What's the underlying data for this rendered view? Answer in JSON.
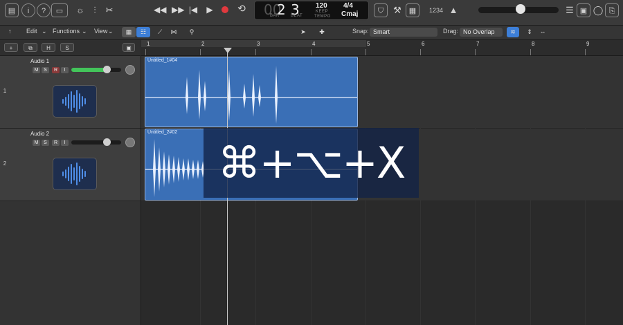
{
  "control_bar": {
    "left_icons": [
      "library-icon",
      "info-icon",
      "help-icon",
      "toolbar-icon"
    ],
    "mid_icons": [
      "smart-controls-icon",
      "mixer-icon",
      "editors-icon"
    ],
    "transport": [
      "rewind-icon",
      "fast-forward-icon",
      "go-to-start-icon",
      "play-icon",
      "record-icon",
      "cycle-icon"
    ],
    "lcd": {
      "bar": "2",
      "bar_label": "BAR",
      "beat": "3",
      "beat_label": "BEAT",
      "tempo": "120",
      "tempo_keep": "KEEP",
      "tempo_label": "TEMPO",
      "time_signature": "4/4",
      "key": "Cmaj"
    },
    "right_icons": [
      "list-editors-icon",
      "note-pad-icon",
      "loop-browser-icon",
      "browser-icon"
    ],
    "extra": "1234",
    "master_volume_percent": 50
  },
  "toolbar": {
    "edit": "Edit",
    "functions": "Functions",
    "view": "View",
    "snap_label": "Snap:",
    "snap_value": "Smart",
    "drag_label": "Drag:",
    "drag_value": "No Overlap"
  },
  "header_buttons": [
    "+",
    "H",
    "S"
  ],
  "tracks": [
    {
      "number": "1",
      "name": "Audio 1",
      "buttons": [
        "M",
        "S",
        "R",
        "I"
      ],
      "volume_percent": 70,
      "region_name": "Untitled_1#04"
    },
    {
      "number": "2",
      "name": "Audio 2",
      "buttons": [
        "M",
        "S",
        "R",
        "I"
      ],
      "volume_percent": 70,
      "region_name": "Untitled_2#02"
    }
  ],
  "ruler": {
    "bars": [
      "1",
      "2",
      "3",
      "4",
      "5",
      "6",
      "7",
      "8",
      "9"
    ],
    "playhead_bar": 2.5
  },
  "overlay": {
    "shortcut": "⌘+⌥+X"
  },
  "colors": {
    "region": "#3a6fb6",
    "fader_green": "#43c45a",
    "record_red": "#e0393e",
    "accent_blue": "#3d7fd8"
  }
}
